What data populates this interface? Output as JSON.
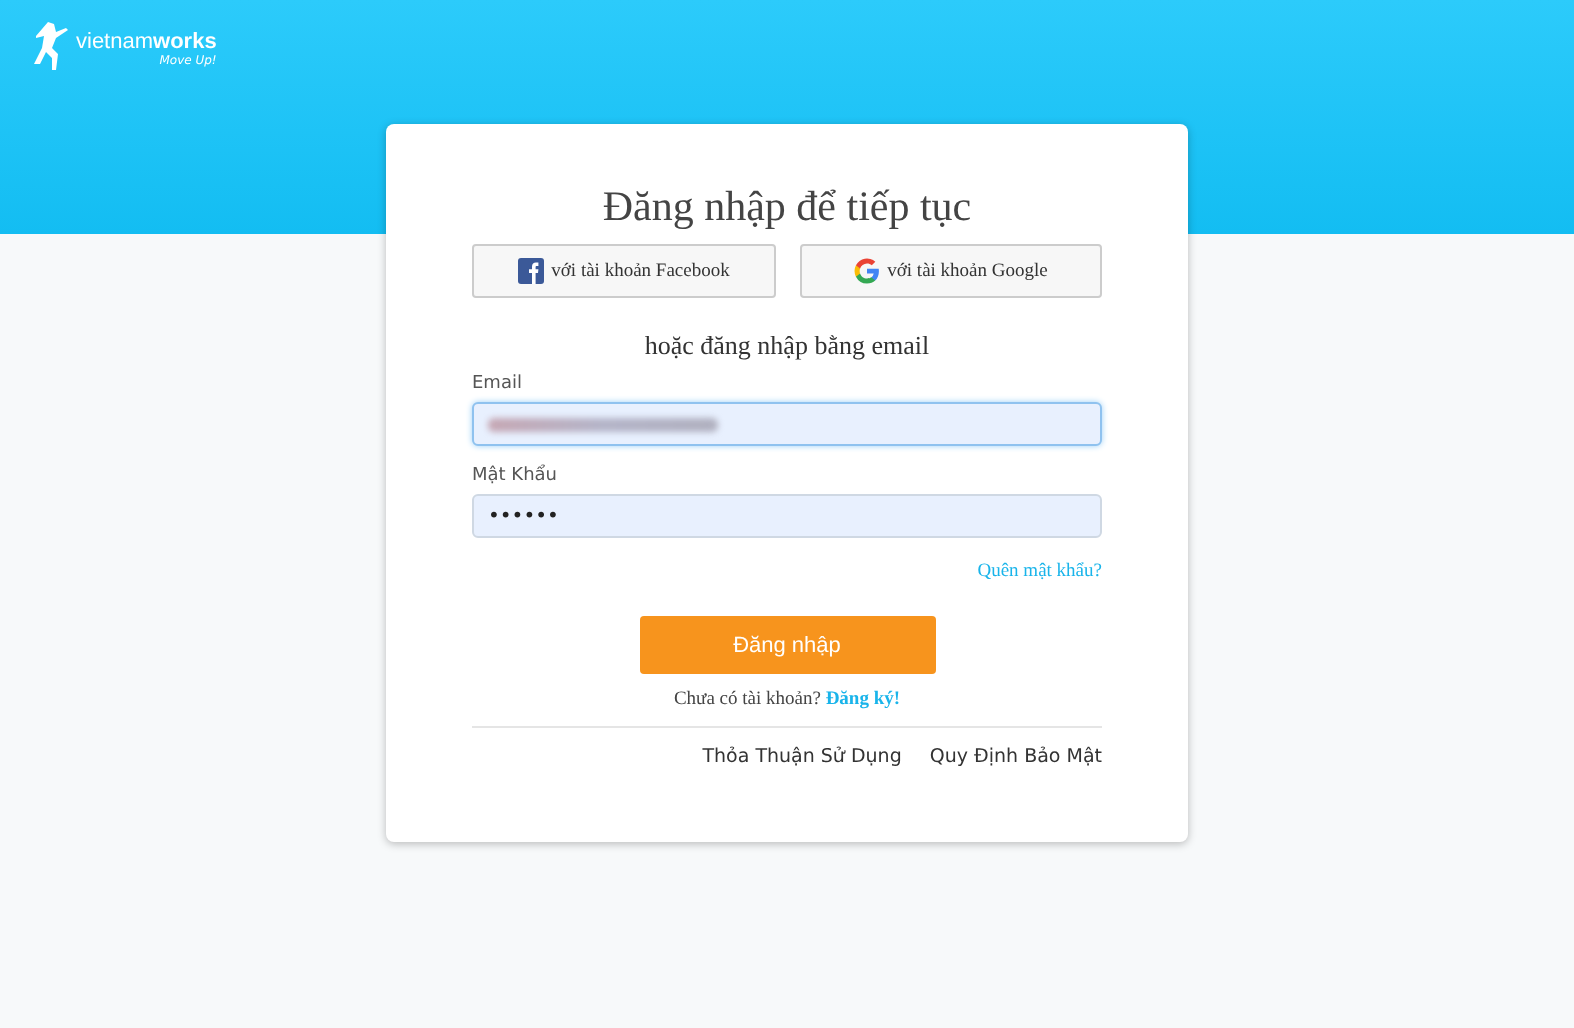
{
  "logo": {
    "brand_light": "vietnam",
    "brand_bold": "works",
    "tagline": "Move Up!"
  },
  "title": "Đăng nhập để tiếp tục",
  "social_buttons": [
    {
      "kind": "facebook",
      "label": "với tài khoản Facebook"
    },
    {
      "kind": "google",
      "label": "với tài khoản Google"
    }
  ],
  "divider_text": "hoặc đăng nhập bằng email",
  "fields": [
    {
      "label": "Email",
      "kind": "blurred",
      "focused": true
    },
    {
      "label": "Mật Khẩu",
      "kind": "password",
      "value": "••••••",
      "focused": false
    }
  ],
  "forgot_link": "Quên mật khẩu?",
  "submit": "Đăng nhập",
  "signup": {
    "text": "Chưa có tài khoản?",
    "link": "Đăng ký!"
  },
  "footer_links": [
    "Thỏa Thuận Sử Dụng",
    "Quy Định Bảo Mật"
  ]
}
